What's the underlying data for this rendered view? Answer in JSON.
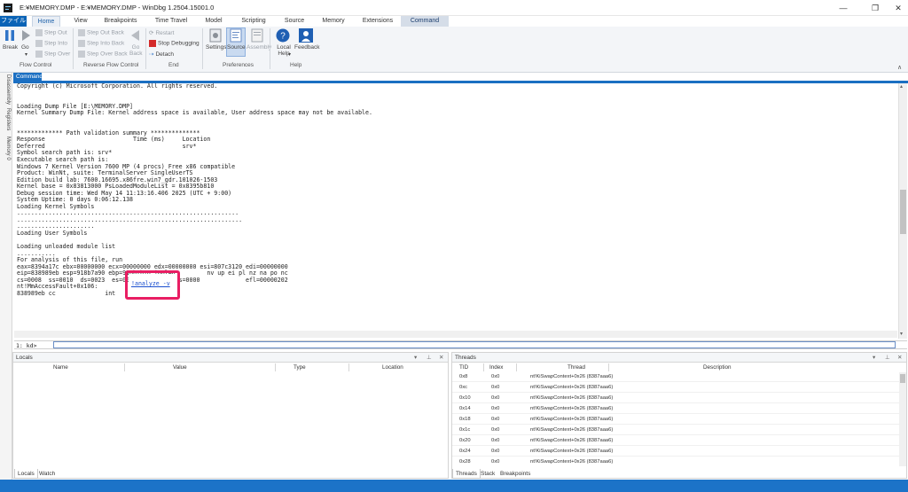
{
  "window": {
    "title": "E:¥MEMORY.DMP - E:¥MEMORY.DMP - WinDbg 1.2504.15001.0",
    "minimize_glyph": "—",
    "maximize_glyph": "❐",
    "close_glyph": "✕"
  },
  "ribbon_tabs": {
    "file": "ファイル",
    "home": "Home",
    "view": "View",
    "breakpoints": "Breakpoints",
    "time_travel": "Time Travel",
    "model": "Model",
    "scripting": "Scripting",
    "source": "Source",
    "memory": "Memory",
    "extensions": "Extensions",
    "command": "Command"
  },
  "ribbon": {
    "flow_control": {
      "label": "Flow Control",
      "break": "Break",
      "go": "Go",
      "step_out": "Step Out",
      "step_into": "Step Into",
      "step_over": "Step Over"
    },
    "reverse_flow": {
      "label": "Reverse Flow Control",
      "step_out_back": "Step Out Back",
      "step_into_back": "Step Into Back",
      "step_over_back": "Step Over Back",
      "go_back": "Go Back"
    },
    "end": {
      "label": "End",
      "restart": "Restart",
      "stop_debugging": "Stop Debugging",
      "detach": "Detach"
    },
    "preferences": {
      "label": "Preferences",
      "settings": "Settings",
      "source": "Source",
      "assembly": "Assembly"
    },
    "help": {
      "label": "Help",
      "local_help": "Local Help",
      "feedback": "Feedback"
    }
  },
  "command_window": {
    "tab_label": "Command",
    "output_lines": [
      "Copyright (c) Microsoft Corporation. All rights reserved.",
      "",
      "",
      "Loading Dump File [E:\\MEMORY.DMP]",
      "Kernel Summary Dump File: Kernel address space is available, User address space may not be available.",
      "",
      "",
      "************* Path validation summary **************",
      "Response                         Time (ms)     Location",
      "Deferred                                       srv*",
      "Symbol search path is: srv*",
      "Executable search path is:",
      "Windows 7 Kernel Version 7600 MP (4 procs) Free x86 compatible",
      "Product: WinNt, suite: TerminalServer SingleUserTS",
      "Edition build lab: 7600.16695.x86fre.win7_gdr.101026-1503",
      "Kernel base = 0x83813000 PsLoadedModuleList = 0x8395b810",
      "Debug session time: Wed May 14 11:13:16.406 2025 (UTC + 9:00)",
      "System Uptime: 0 days 0:06:12.138",
      "Loading Kernel Symbols",
      "...............................................................",
      "................................................................",
      "......................",
      "Loading User Symbols",
      "",
      "Loading unloaded module list",
      "...........",
      "For analysis of this file, run",
      "eax=8394a17c ebx=00000000 ecx=00000000 edx=00000000 esi=807c3120 edi=00000000",
      "eip=838989eb esp=918b7a90 ebp=918b7b10 iopl=0         nv up ei pl nz na po nc",
      "cs=0008  ss=0010  ds=0023  es=0023  fs=0030  gs=0000             efl=00000202",
      "nt!MmAccessFault+0x106:",
      "838989eb cc              int     3"
    ],
    "analyze_link": "!analyze -v",
    "prompt": "1: kd>",
    "input_value": ""
  },
  "side_tabs": [
    "Disassembly",
    "Registers",
    "Memory 0"
  ],
  "locals_panel": {
    "title": "Locals",
    "columns": [
      "Name",
      "Value",
      "Type",
      "Location"
    ],
    "bottom_tabs": [
      "Locals",
      "Watch"
    ]
  },
  "threads_panel": {
    "title": "Threads",
    "columns": [
      "TID",
      "Index",
      "Thread",
      "Description"
    ],
    "rows": [
      {
        "tid": "0x8",
        "index": "0x0",
        "thread": "nt!KiSwapContext+0x26 (8387aaa6)"
      },
      {
        "tid": "0xc",
        "index": "0x0",
        "thread": "nt!KiSwapContext+0x26 (8387aaa6)"
      },
      {
        "tid": "0x10",
        "index": "0x0",
        "thread": "nt!KiSwapContext+0x26 (8387aaa6)"
      },
      {
        "tid": "0x14",
        "index": "0x0",
        "thread": "nt!KiSwapContext+0x26 (8387aaa6)"
      },
      {
        "tid": "0x18",
        "index": "0x0",
        "thread": "nt!KiSwapContext+0x26 (8387aaa6)"
      },
      {
        "tid": "0x1c",
        "index": "0x0",
        "thread": "nt!KiSwapContext+0x26 (8387aaa6)"
      },
      {
        "tid": "0x20",
        "index": "0x0",
        "thread": "nt!KiSwapContext+0x26 (8387aaa6)"
      },
      {
        "tid": "0x24",
        "index": "0x0",
        "thread": "nt!KiSwapContext+0x26 (8387aaa6)"
      },
      {
        "tid": "0x28",
        "index": "0x0",
        "thread": "nt!KiSwapContext+0x26 (8387aaa6)"
      }
    ],
    "bottom_tabs": [
      "Threads",
      "Stack",
      "Breakpoints"
    ]
  },
  "panel_controls": {
    "dropdown": "▾",
    "pin": "⊥",
    "close": "✕"
  },
  "colors": {
    "accent": "#1c73c8",
    "highlight": "#e91e63",
    "link": "#1a4fcf"
  }
}
